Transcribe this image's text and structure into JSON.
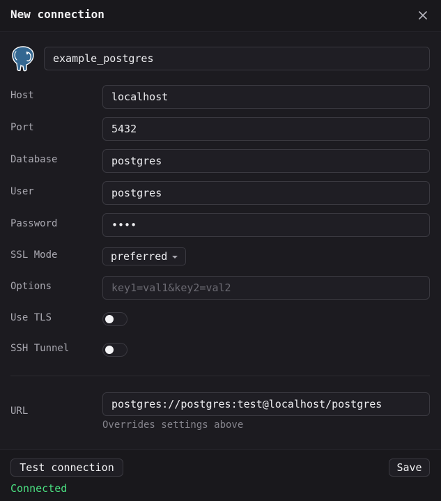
{
  "dialog": {
    "title": "New connection",
    "close_icon": "close-icon"
  },
  "connection": {
    "name": "example_postgres",
    "logo_icon": "postgresql-elephant-icon"
  },
  "form": {
    "host": {
      "label": "Host",
      "value": "localhost"
    },
    "port": {
      "label": "Port",
      "value": "5432"
    },
    "database": {
      "label": "Database",
      "value": "postgres"
    },
    "user": {
      "label": "User",
      "value": "postgres"
    },
    "password": {
      "label": "Password",
      "value": "test"
    },
    "ssl_mode": {
      "label": "SSL Mode",
      "value": "preferred"
    },
    "options": {
      "label": "Options",
      "value": "",
      "placeholder": "key1=val1&key2=val2"
    },
    "use_tls": {
      "label": "Use TLS",
      "enabled": false
    },
    "ssh_tunnel": {
      "label": "SSH Tunnel",
      "enabled": false
    },
    "url": {
      "label": "URL",
      "value": "postgres://postgres:test@localhost/postgres",
      "hint": "Overrides settings above"
    }
  },
  "footer": {
    "test_label": "Test connection",
    "save_label": "Save",
    "status": "Connected"
  },
  "colors": {
    "background": "#1c1b20",
    "status_success": "#4ade80",
    "logo_blue": "#336791"
  }
}
